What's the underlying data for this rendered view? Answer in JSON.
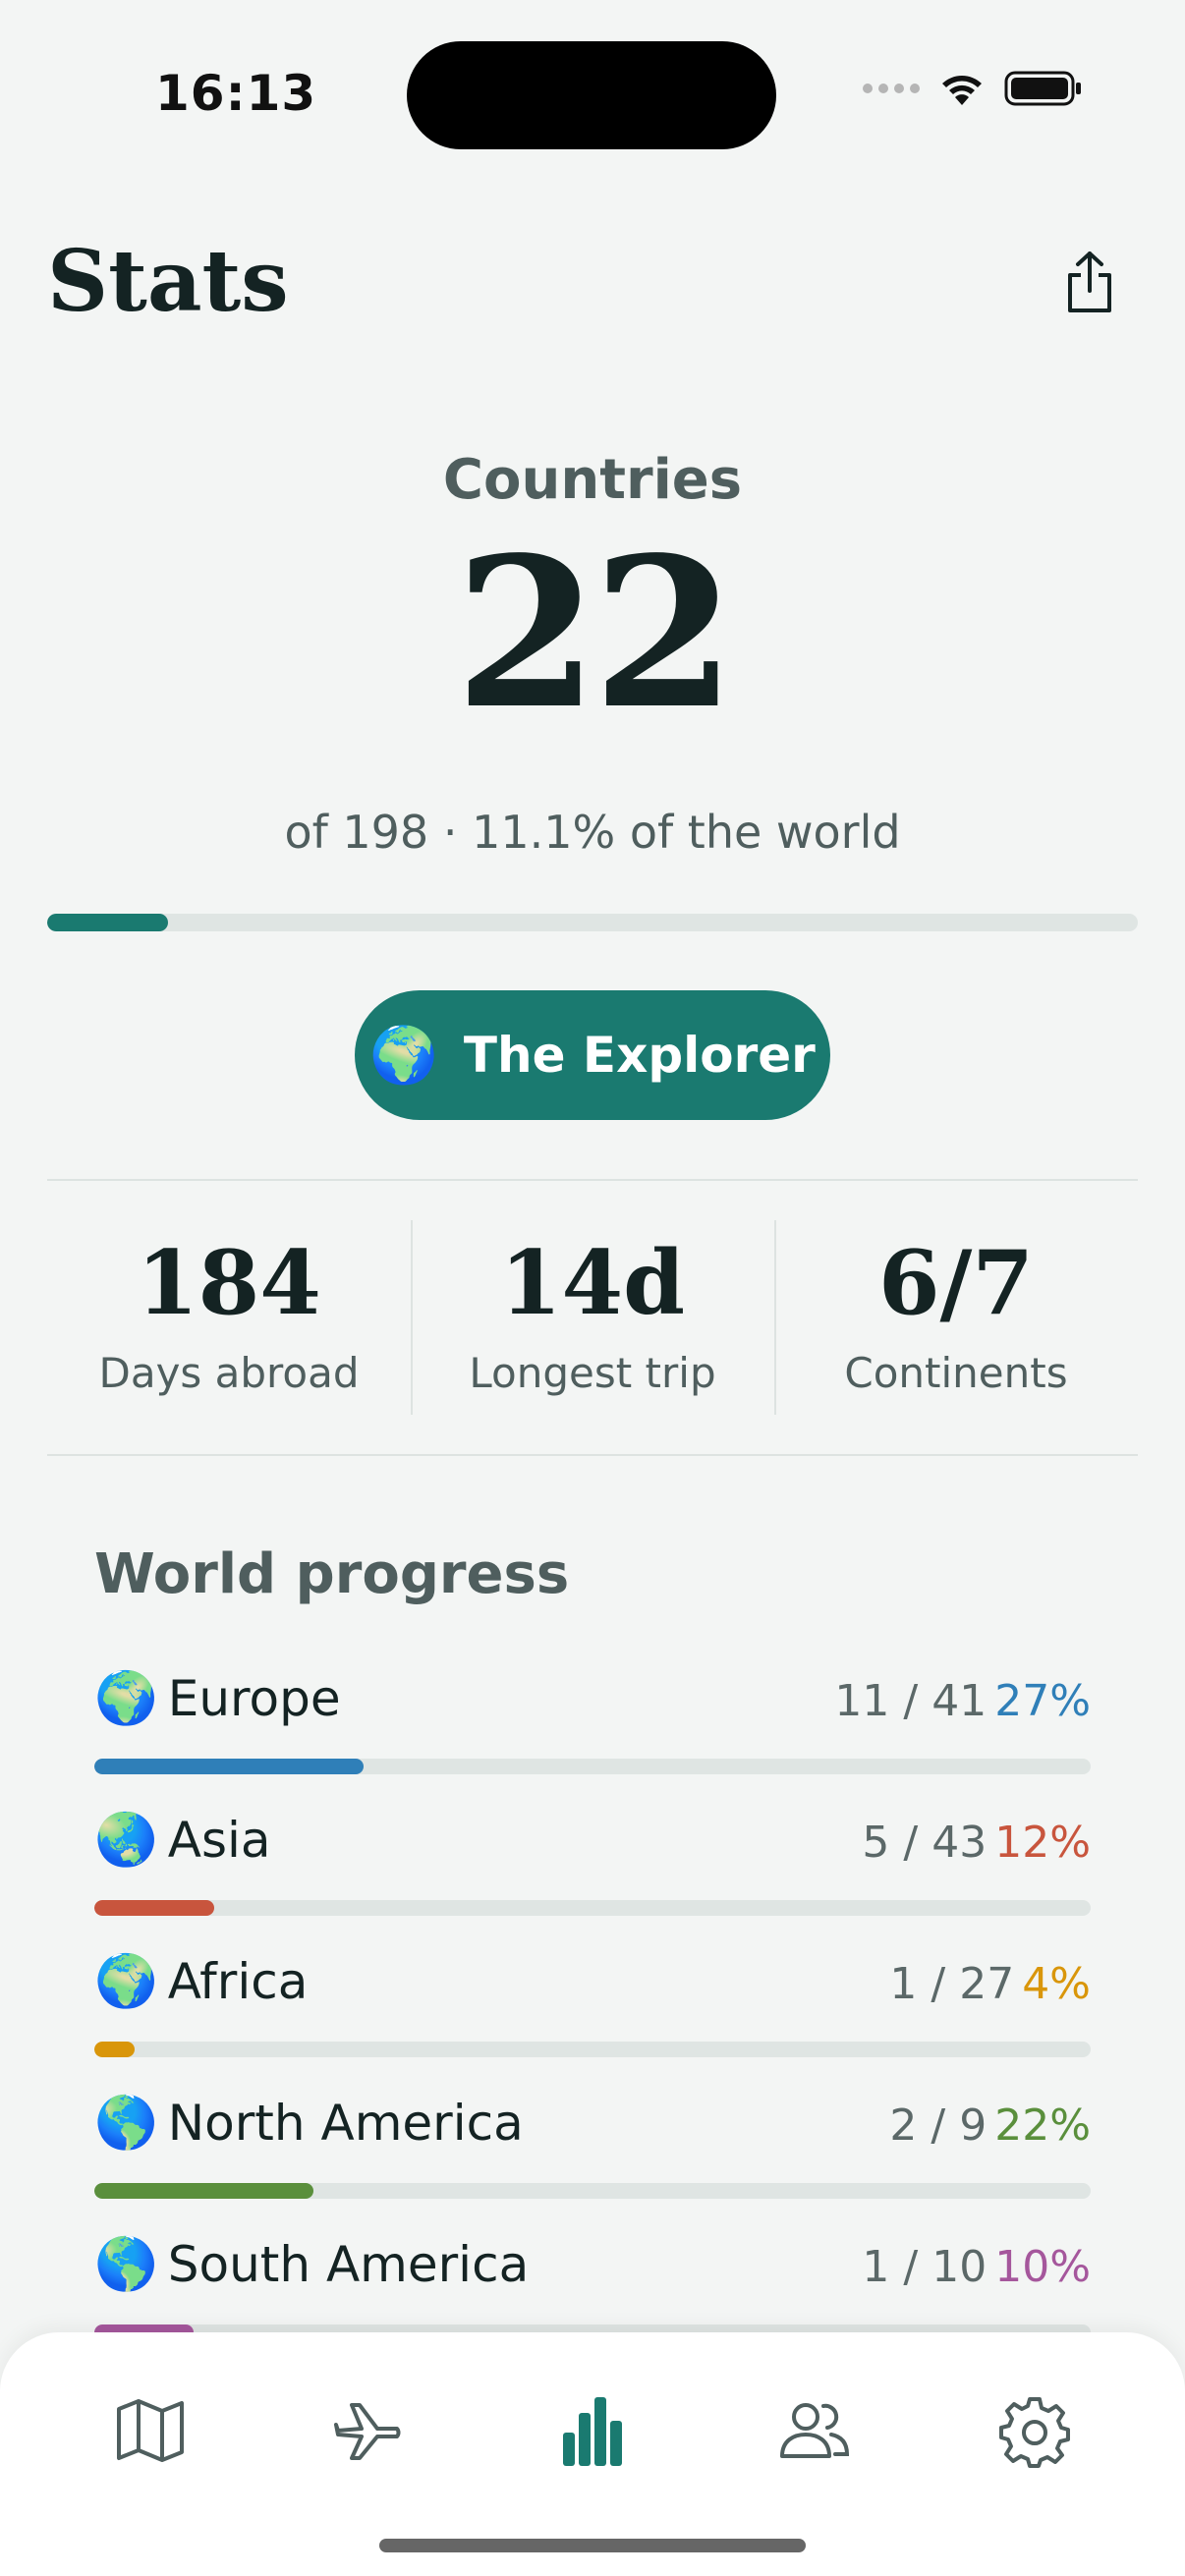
{
  "status_bar": {
    "time": "16:13"
  },
  "header": {
    "title": "Stats"
  },
  "hero": {
    "label": "Countries",
    "count": "22",
    "subtitle": "of 198 · 11.1% of the world",
    "progress_fraction": 0.111
  },
  "badge": {
    "emoji": "🌍",
    "label": "The Explorer"
  },
  "stats": [
    {
      "value": "184",
      "label": "Days abroad"
    },
    {
      "value": "14d",
      "label": "Longest trip"
    },
    {
      "value": "6/7",
      "label": "Continents"
    }
  ],
  "world_progress": {
    "title": "World progress",
    "items": [
      {
        "emoji": "🌍",
        "name": "Europe",
        "count": "11 / 41",
        "pct": "27%",
        "fraction": 0.27,
        "color": "#2f7fb8"
      },
      {
        "emoji": "🌏",
        "name": "Asia",
        "count": "5 / 43",
        "pct": "12%",
        "fraction": 0.12,
        "color": "#c8553d"
      },
      {
        "emoji": "🌍",
        "name": "Africa",
        "count": "1 / 27",
        "pct": "4%",
        "fraction": 0.04,
        "color": "#d9960a"
      },
      {
        "emoji": "🌎",
        "name": "North America",
        "count": "2 / 9",
        "pct": "22%",
        "fraction": 0.22,
        "color": "#5a8f3c"
      },
      {
        "emoji": "🌎",
        "name": "South America",
        "count": "1 / 10",
        "pct": "10%",
        "fraction": 0.1,
        "color": "#a5579c"
      }
    ]
  },
  "tab_bar": {
    "tabs": [
      {
        "icon": "map-icon",
        "active": false
      },
      {
        "icon": "airplane-icon",
        "active": false
      },
      {
        "icon": "bar-chart-icon",
        "active": true
      },
      {
        "icon": "people-icon",
        "active": false
      },
      {
        "icon": "gear-icon",
        "active": false
      }
    ],
    "active_color": "#1a7a70",
    "inactive_color": "#4f5e5e"
  }
}
